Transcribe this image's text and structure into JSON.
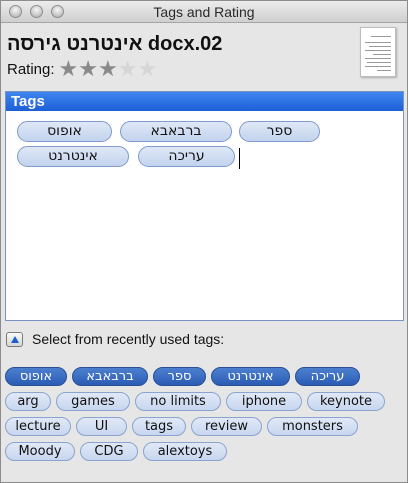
{
  "window": {
    "title": "Tags and Rating"
  },
  "document": {
    "title": "אינטרנט גירסה docx.02",
    "rating_label": "Rating:",
    "rating": 3,
    "rating_max": 5
  },
  "tags": {
    "header": "Tags",
    "items": [
      "ספר",
      "ברבאבא",
      "אופוס",
      "עריכה",
      "אינטרנט"
    ]
  },
  "recent": {
    "label": "Select from recently used tags:",
    "selected": [
      "עריכה",
      "אינטרנט",
      "ספר",
      "ברבאבא",
      "אופוס"
    ],
    "others": [
      "arg",
      "games",
      "no limits",
      "iphone",
      "keynote",
      "lecture",
      "UI",
      "tags",
      "review",
      "monsters",
      "Moody",
      "CDG",
      "alextoys"
    ]
  },
  "colors": {
    "accent": "#1d5fd6",
    "chip_fill": "#c3d3ee",
    "selected_chip": "#2a5cb5"
  }
}
